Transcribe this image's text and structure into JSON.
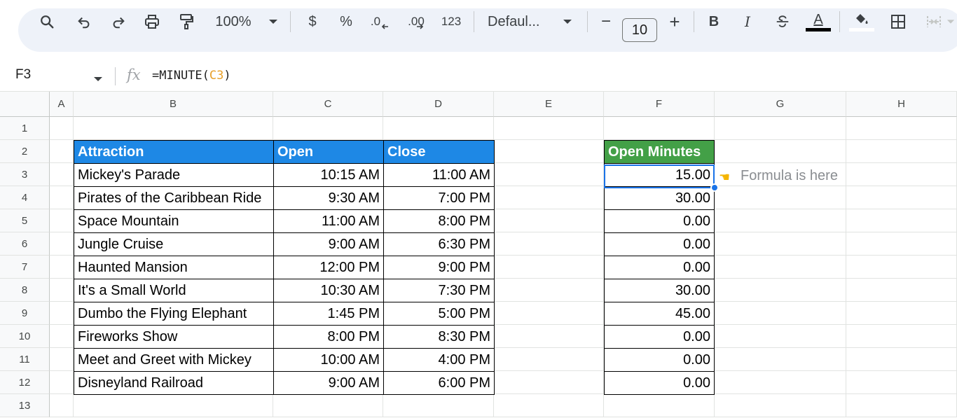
{
  "toolbar": {
    "zoom": "100%",
    "currency": "$",
    "percent": "%",
    "decrease_decimal": ".0",
    "increase_decimal": ".00",
    "number_format": "123",
    "font": "Defaul...",
    "minus": "−",
    "font_size": "10",
    "plus": "+",
    "bold": "B",
    "italic": "I",
    "text_color_letter": "A"
  },
  "formula_bar": {
    "name_box": "F3",
    "fx": "fx",
    "formula_prefix": "=MINUTE(",
    "formula_ref": "C3",
    "formula_suffix": ")"
  },
  "columns": [
    "A",
    "B",
    "C",
    "D",
    "E",
    "F",
    "G",
    "H"
  ],
  "rows": [
    "1",
    "2",
    "3",
    "4",
    "5",
    "6",
    "7",
    "8",
    "9",
    "10",
    "11",
    "12",
    "13"
  ],
  "table": {
    "headers": [
      "Attraction",
      "Open",
      "Close"
    ],
    "rows": [
      [
        "Mickey's Parade",
        "10:15 AM",
        "11:00 AM"
      ],
      [
        "Pirates of the Caribbean Ride",
        "9:30 AM",
        "7:00 PM"
      ],
      [
        "Space Mountain",
        "11:00 AM",
        "8:00 PM"
      ],
      [
        "Jungle Cruise",
        "9:00 AM",
        "6:30 PM"
      ],
      [
        "Haunted Mansion",
        "12:00 PM",
        "9:00 PM"
      ],
      [
        "It's a Small World",
        "10:30 AM",
        "7:30 PM"
      ],
      [
        "Dumbo the Flying Elephant",
        "1:45 PM",
        "5:00 PM"
      ],
      [
        "Fireworks Show",
        "8:00 PM",
        "8:30 PM"
      ],
      [
        "Meet and Greet with Mickey",
        "10:00 AM",
        "4:00 PM"
      ],
      [
        "Disneyland Railroad",
        "9:00 AM",
        "6:00 PM"
      ]
    ]
  },
  "minutes": {
    "header": "Open Minutes",
    "values": [
      "15.00",
      "30.00",
      "0.00",
      "0.00",
      "0.00",
      "30.00",
      "45.00",
      "0.00",
      "0.00",
      "0.00"
    ]
  },
  "note": "Formula is here",
  "colors": {
    "header_blue": "#1e88e5",
    "header_green": "#43a047",
    "selection": "#1a73e8"
  }
}
